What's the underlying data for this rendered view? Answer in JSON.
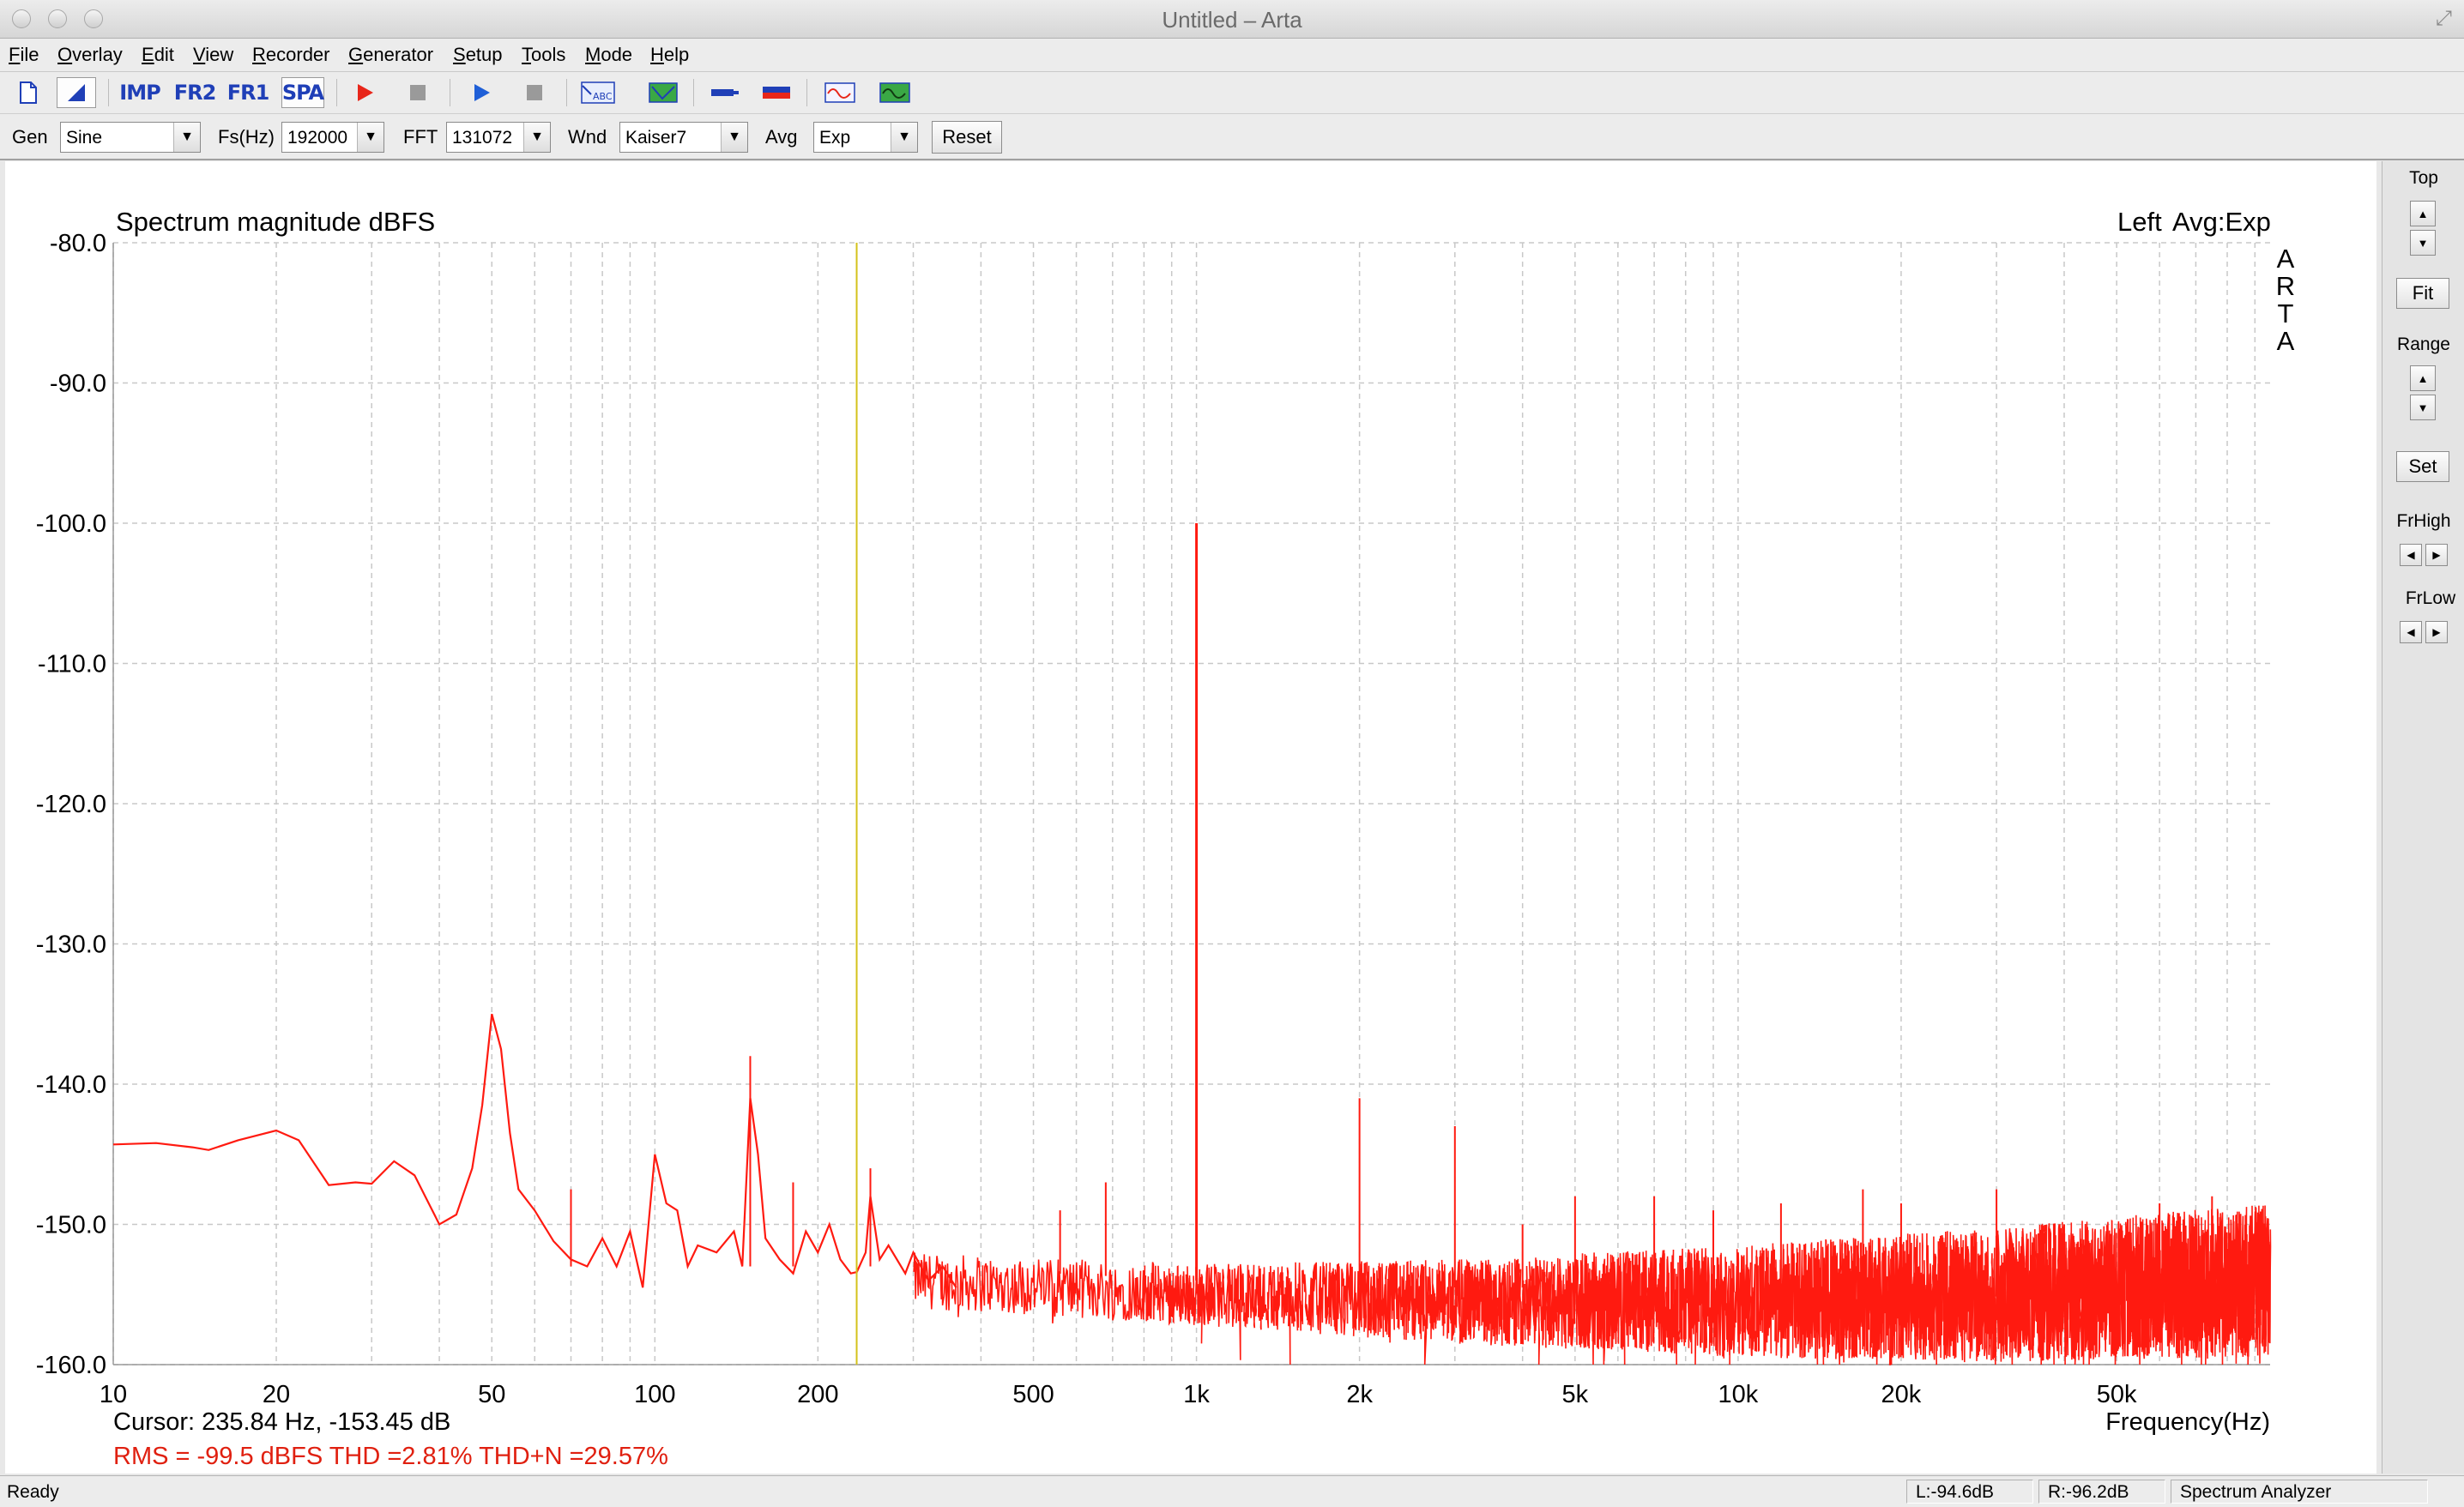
{
  "window": {
    "title": "Untitled – Arta",
    "resize_icon": "resize-icon"
  },
  "menu": [
    "File",
    "Overlay",
    "Edit",
    "View",
    "Recorder",
    "Generator",
    "Setup",
    "Tools",
    "Mode",
    "Help"
  ],
  "toolbar": {
    "imp_label": "IMP",
    "fr2_label": "FR2",
    "fr1_label": "FR1",
    "spa_label": "SPA",
    "pressed": [
      "sweep-mode",
      "spa"
    ]
  },
  "params": {
    "gen_label": "Gen",
    "gen_value": "Sine",
    "fs_label": "Fs(Hz)",
    "fs_value": "192000",
    "fft_label": "FFT",
    "fft_value": "131072",
    "wnd_label": "Wnd",
    "wnd_value": "Kaiser7",
    "avg_label": "Avg",
    "avg_value": "Exp",
    "reset_label": "Reset"
  },
  "right_panel": {
    "top_label": "Top",
    "fit_label": "Fit",
    "range_label": "Range",
    "set_label": "Set",
    "frhigh_label": "FrHigh",
    "frlow_label": "FrLow"
  },
  "plot": {
    "cursor_text": "Cursor: 235.84 Hz, -153.45 dB",
    "stats_text": "RMS =  -99.5 dBFS   THD =2.81%   THD+N =29.57%",
    "arta_mark": [
      "A",
      "R",
      "T",
      "A"
    ]
  },
  "chart_data": {
    "type": "line",
    "title": "Spectrum magnitude dBFS",
    "channel_label": "Left",
    "avg_label": "Avg:Exp",
    "xlabel": "Frequency(Hz)",
    "ylabel": "",
    "x_scale": "log",
    "xlim": [
      10,
      96000
    ],
    "ylim": [
      -160,
      -80
    ],
    "x_ticks": [
      10,
      20,
      50,
      100,
      200,
      500,
      1000,
      2000,
      5000,
      10000,
      20000,
      50000
    ],
    "x_tick_labels": [
      "10",
      "20",
      "50",
      "100",
      "200",
      "500",
      "1k",
      "2k",
      "5k",
      "10k",
      "20k",
      "50k"
    ],
    "y_ticks": [
      -80,
      -90,
      -100,
      -110,
      -120,
      -130,
      -140,
      -150,
      -160
    ],
    "y_tick_labels": [
      "-80.0",
      "-90.0",
      "-100.0",
      "-110.0",
      "-120.0",
      "-130.0",
      "-140.0",
      "-150.0",
      "-160.0"
    ],
    "grid": true,
    "series_color": "#ff1a10",
    "cursor_color": "#d4c21a",
    "cursor_x": 235.84,
    "series": [
      {
        "x": [
          10,
          12,
          14,
          15,
          17,
          20,
          22,
          25,
          28,
          30,
          33,
          36,
          40,
          43,
          46,
          48,
          50,
          52,
          54,
          56,
          60,
          65,
          70,
          75,
          80,
          85,
          90,
          95,
          100,
          105,
          110,
          115,
          120,
          130,
          140,
          145,
          150,
          155,
          160,
          170,
          180,
          190,
          200,
          210,
          220,
          230,
          236,
          245,
          250,
          260,
          270,
          290,
          300,
          320,
          340,
          360
        ],
        "y": [
          -144.3,
          -144.2,
          -144.5,
          -144.7,
          -144.0,
          -143.3,
          -144.0,
          -147.2,
          -147.0,
          -147.1,
          -145.5,
          -146.5,
          -150.0,
          -149.3,
          -146.0,
          -141.5,
          -135.0,
          -137.5,
          -143.5,
          -147.5,
          -149.0,
          -151.2,
          -152.5,
          -153.0,
          -151.0,
          -153.0,
          -150.5,
          -154.5,
          -145.0,
          -148.5,
          -149.0,
          -153.0,
          -151.5,
          -152.0,
          -150.5,
          -153.0,
          -141.0,
          -145.0,
          -151.0,
          -152.5,
          -153.5,
          -150.5,
          -152.0,
          -150.0,
          -152.5,
          -153.5,
          -153.4,
          -152.0,
          -148.0,
          -152.5,
          -151.5,
          -153.5,
          -152.0,
          -154.0,
          -153.0,
          -154.5
        ]
      }
    ],
    "spikes": [
      {
        "x": 70,
        "y": -147.5
      },
      {
        "x": 150,
        "y": -138.0
      },
      {
        "x": 180,
        "y": -147.0
      },
      {
        "x": 250,
        "y": -146.0
      },
      {
        "x": 560,
        "y": -149.0
      },
      {
        "x": 680,
        "y": -147.0
      },
      {
        "x": 1000,
        "y": -100.0
      },
      {
        "x": 2000,
        "y": -141.0
      },
      {
        "x": 3000,
        "y": -143.0
      },
      {
        "x": 4000,
        "y": -150.0
      },
      {
        "x": 5000,
        "y": -148.0
      },
      {
        "x": 7000,
        "y": -148.0
      },
      {
        "x": 9000,
        "y": -149.0
      },
      {
        "x": 12000,
        "y": -148.5
      },
      {
        "x": 17000,
        "y": -147.5
      },
      {
        "x": 20000,
        "y": -148.5
      },
      {
        "x": 30000,
        "y": -147.5
      },
      {
        "x": 40000,
        "y": -150.0
      },
      {
        "x": 60000,
        "y": -148.5
      },
      {
        "x": 75000,
        "y": -148.0
      }
    ],
    "noise_floor": [
      {
        "x": 300,
        "y_center": -154.0,
        "spread": 2.0
      },
      {
        "x": 1000,
        "y_center": -155.0,
        "spread": 2.2
      },
      {
        "x": 3000,
        "y_center": -155.5,
        "spread": 3.0
      },
      {
        "x": 10000,
        "y_center": -155.5,
        "spread": 4.0
      },
      {
        "x": 30000,
        "y_center": -155.0,
        "spread": 4.8
      },
      {
        "x": 96000,
        "y_center": -154.0,
        "spread": 5.5
      }
    ]
  },
  "status": {
    "ready": "Ready",
    "left_level": "L:-94.6dB",
    "right_level": "R:-96.2dB",
    "mode": "Spectrum Analyzer"
  }
}
